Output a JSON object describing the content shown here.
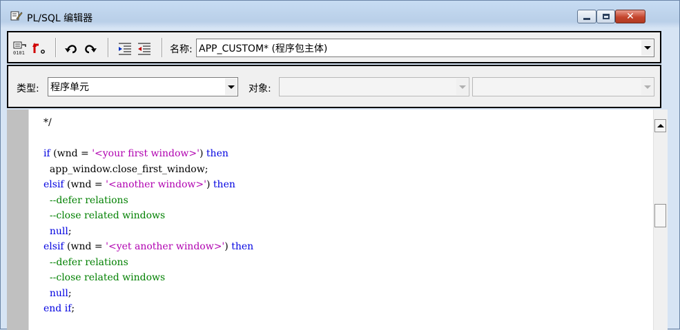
{
  "window": {
    "title": "PL/SQL 编辑器"
  },
  "toolbar": {
    "name_label": "名称:",
    "name_value": "APP_CUSTOM* (程序包主体)"
  },
  "filter": {
    "type_label": "类型:",
    "type_value": "程序单元",
    "object_label": "对象:",
    "object_value_1": "",
    "object_value_2": ""
  },
  "code": {
    "line1": "*/",
    "line2": "",
    "line3_kw": "if",
    "line3_a": " (wnd = ",
    "line3_str": "'<your first window>'",
    "line3_b": ") ",
    "line3_kw2": "then",
    "line4": "  app_window.close_first_window;",
    "line5_kw": "elsif",
    "line5_a": " (wnd = ",
    "line5_str": "'<another window>'",
    "line5_b": ") ",
    "line5_kw2": "then",
    "line6": "  --defer relations",
    "line7": "  --close related windows",
    "line8": "  null",
    "line8_end": ";",
    "line9_kw": "elsif",
    "line9_a": " (wnd = ",
    "line9_str": "'<yet another window>'",
    "line9_b": ") ",
    "line9_kw2": "then",
    "line10": "  --defer relations",
    "line11": "  --close related windows",
    "line12": "  null",
    "line12_end": ";",
    "line13_kw": "end if",
    "line13_end": ";"
  },
  "colors": {
    "keyword": "#0000e0",
    "string": "#b000b0",
    "comment": "#008000"
  },
  "icons": [
    "edit-icon",
    "compile-icon",
    "goto-icon",
    "undo-icon",
    "redo-icon",
    "indent-icon",
    "unindent-icon"
  ]
}
